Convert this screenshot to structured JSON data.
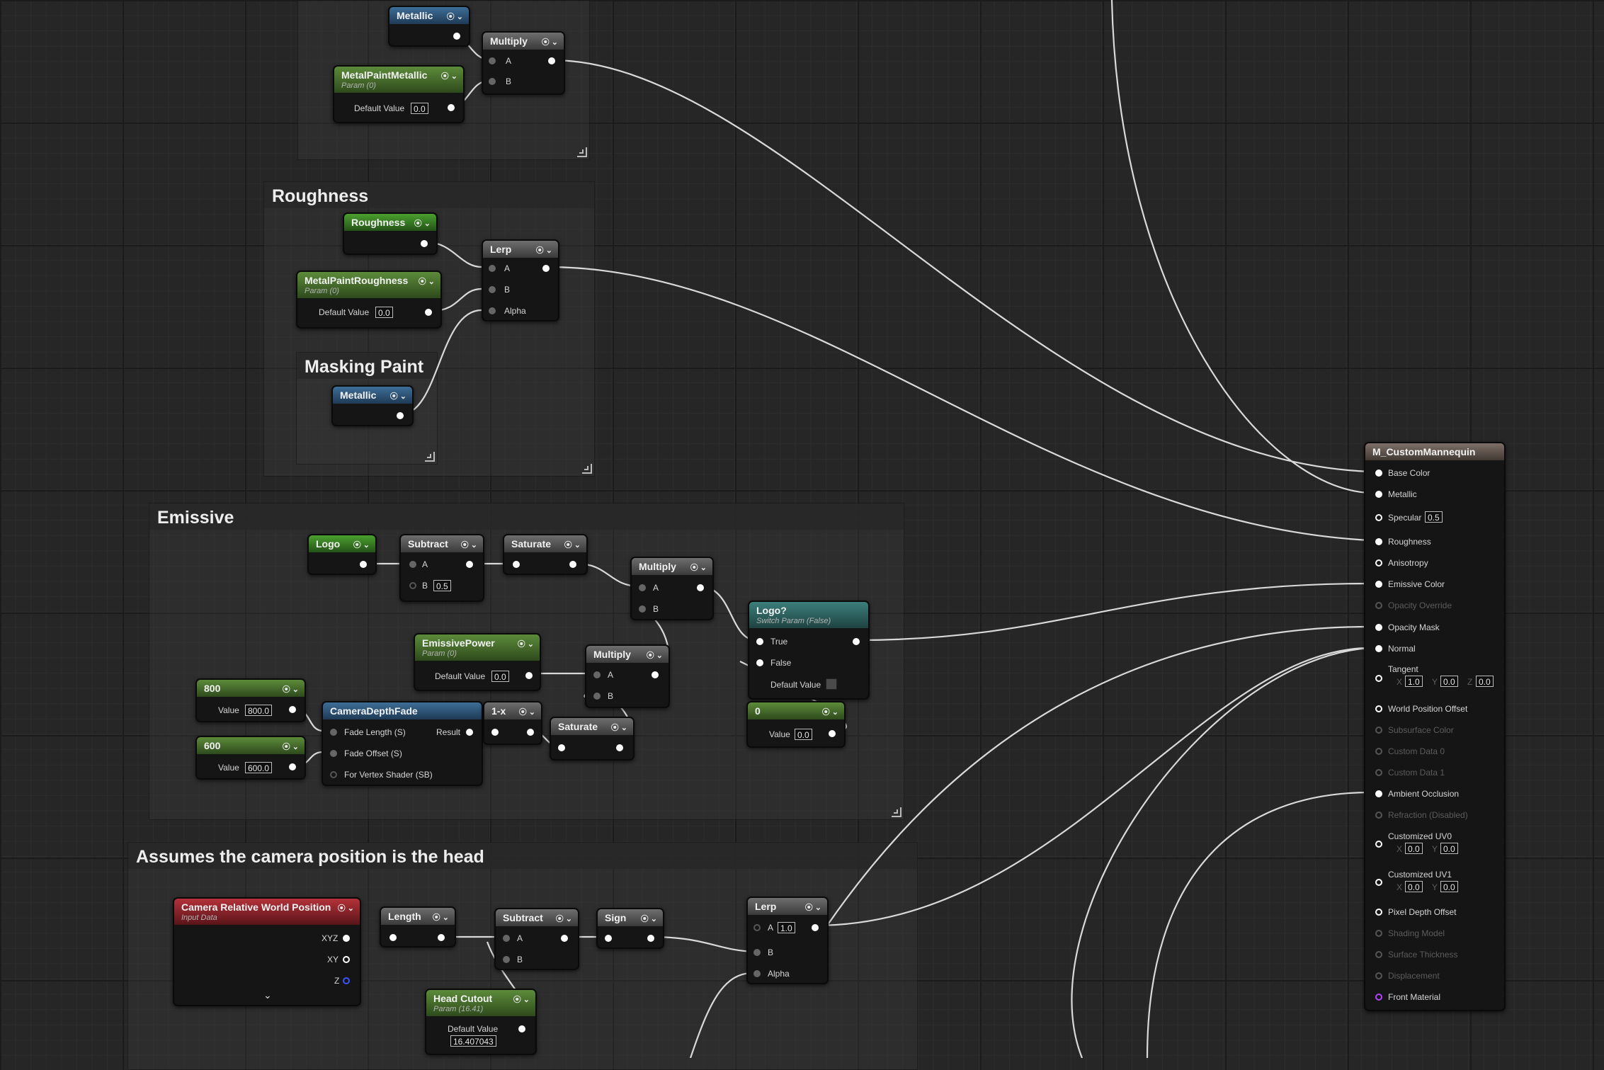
{
  "comments": {
    "roughness": "Roughness",
    "masking_paint": "Masking Paint",
    "emissive": "Emissive",
    "camera": "Assumes the camera position is the head"
  },
  "nodes": {
    "metallic_top": "Metallic",
    "multiply_top": "Multiply",
    "metal_paint_metallic": {
      "title": "MetalPaintMetallic",
      "sub": "Param (0)",
      "default_label": "Default Value",
      "value": "0.0"
    },
    "roughness": "Roughness",
    "metal_paint_roughness": {
      "title": "MetalPaintRoughness",
      "sub": "Param (0)",
      "default_label": "Default Value",
      "value": "0.0"
    },
    "lerp_rough": "Lerp",
    "metallic_mask": "Metallic",
    "logo": "Logo",
    "subtract_em": {
      "title": "Subtract",
      "b": "0.5"
    },
    "saturate1": "Saturate",
    "multiply_em": "Multiply",
    "emissive_power": {
      "title": "EmissivePower",
      "sub": "Param (0)",
      "default_label": "Default Value",
      "value": "0.0"
    },
    "multiply_em2": "Multiply",
    "logo_switch": {
      "title": "Logo?",
      "sub": "Switch Param (False)",
      "true_label": "True",
      "false_label": "False",
      "default_label": "Default Value"
    },
    "const800": {
      "title": "800",
      "value_label": "Value",
      "value": "800.0"
    },
    "const600": {
      "title": "600",
      "value_label": "Value",
      "value": "600.0"
    },
    "camera_depth_fade": {
      "title": "CameraDepthFade",
      "fade_length": "Fade Length (S)",
      "fade_offset": "Fade Offset (S)",
      "vertex": "For Vertex Shader (SB)",
      "result": "Result"
    },
    "one_minus": "1-x",
    "saturate2": "Saturate",
    "const0": {
      "title": "0",
      "value_label": "Value",
      "value": "0.0"
    },
    "camera_pos": {
      "title": "Camera Relative World Position",
      "sub": "Input Data",
      "xyz": "XYZ",
      "xy": "XY",
      "z": "Z"
    },
    "length": "Length",
    "subtract_cam": "Subtract",
    "sign": "Sign",
    "lerp_cam": {
      "title": "Lerp",
      "a": "1.0"
    },
    "head_cutout": {
      "title": "Head Cutout",
      "sub": "Param (16.41)",
      "default_label": "Default Value",
      "value": "16.407043"
    }
  },
  "pin_labels": {
    "a": "A",
    "b": "B",
    "alpha": "Alpha"
  },
  "material": {
    "title": "M_CustomMannequin",
    "base_color": "Base Color",
    "metallic": "Metallic",
    "specular": "Specular",
    "specular_value": "0.5",
    "roughness": "Roughness",
    "anisotropy": "Anisotropy",
    "emissive_color": "Emissive Color",
    "opacity_override": "Opacity Override",
    "opacity_mask": "Opacity Mask",
    "normal": "Normal",
    "tangent": "Tangent",
    "tangent_x": "1.0",
    "tangent_y": "0.0",
    "tangent_z": "0.0",
    "world_position_offset": "World Position Offset",
    "subsurface_color": "Subsurface Color",
    "custom_data_0": "Custom Data 0",
    "custom_data_1": "Custom Data 1",
    "ambient_occlusion": "Ambient Occlusion",
    "refraction": "Refraction (Disabled)",
    "customized_uv0": "Customized UV0",
    "uv0_x": "0.0",
    "uv0_y": "0.0",
    "customized_uv1": "Customized UV1",
    "uv1_x": "0.0",
    "uv1_y": "0.0",
    "pixel_depth_offset": "Pixel Depth Offset",
    "shading_model": "Shading Model",
    "surface_thickness": "Surface Thickness",
    "displacement": "Displacement",
    "front_material": "Front Material",
    "axis_x": "X",
    "axis_y": "Y",
    "axis_z": "Z"
  }
}
